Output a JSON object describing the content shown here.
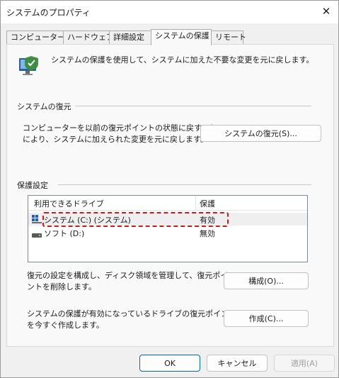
{
  "window": {
    "title": "システムのプロパティ",
    "close_glyph": "✕"
  },
  "tabs": [
    {
      "label": "コンピューター名"
    },
    {
      "label": "ハードウェア"
    },
    {
      "label": "詳細設定"
    },
    {
      "label": "システムの保護"
    },
    {
      "label": "リモート"
    }
  ],
  "active_tab": "システムの保護",
  "intro": {
    "text": "システムの保護を使用して、システムに加えた不要な変更を元に戻します。",
    "icon": "computer-shield-icon"
  },
  "restore": {
    "title": "システムの復元",
    "description_line1": "コンピューターを以前の復元ポイントの状態に戻すこと",
    "description_line2": "により、システムに加えられた変更を元に戻します。",
    "button": "システムの復元(S)..."
  },
  "protection": {
    "title": "保護設定",
    "columns": [
      "利用できるドライブ",
      "保護"
    ],
    "drives": [
      {
        "name": "システム (C:) (システム)",
        "protection": "有効",
        "icon": "system-drive-icon"
      },
      {
        "name": "ソフト (D:)",
        "protection": "無効",
        "icon": "drive-icon"
      }
    ],
    "configure_line1": "復元の設定を構成し、ディスク領域を管理して、復元ポイ",
    "configure_line2": "ントを削除します。",
    "configure_button": "構成(O)...",
    "create_line1": "システムの保護が有効になっているドライブの復元ポイント",
    "create_line2": "を今すぐ作成します。",
    "create_button": "作成(C)..."
  },
  "footer": {
    "ok": "OK",
    "cancel": "キャンセル",
    "apply": "適用(A)"
  },
  "colors": {
    "accent": "#0067c0",
    "highlight_border": "#d01a1a"
  }
}
